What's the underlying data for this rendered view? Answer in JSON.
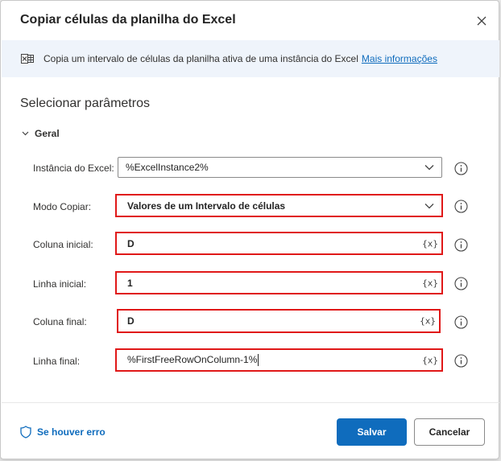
{
  "dialog": {
    "title": "Copiar células da planilha do Excel",
    "close_icon": "close-icon"
  },
  "banner": {
    "icon": "excel-icon",
    "text": "Copia um intervalo de células da planilha ativa de uma instância do Excel",
    "link": "Mais informações"
  },
  "section": {
    "title": "Selecionar parâmetros",
    "group_label": "Geral"
  },
  "fields": {
    "excel_instance": {
      "label": "Instância do Excel:",
      "value": "%ExcelInstance2%"
    },
    "copy_mode": {
      "label": "Modo Copiar:",
      "value": "Valores de um Intervalo de células"
    },
    "start_column": {
      "label": "Coluna inicial:",
      "value": "D",
      "suffix": "{x}"
    },
    "start_row": {
      "label": "Linha inicial:",
      "value": "1",
      "suffix": "{x}"
    },
    "end_column": {
      "label": "Coluna final:",
      "value": "D",
      "suffix": "{x}"
    },
    "end_row": {
      "label": "Linha final:",
      "value": "%FirstFreeRowOnColumn-1%",
      "suffix": "{x}"
    }
  },
  "footer": {
    "error_link": "Se houver erro",
    "save": "Salvar",
    "cancel": "Cancelar"
  },
  "colors": {
    "accent": "#0f6cbd",
    "highlight": "#e01818",
    "banner_bg": "#eff4fb"
  }
}
